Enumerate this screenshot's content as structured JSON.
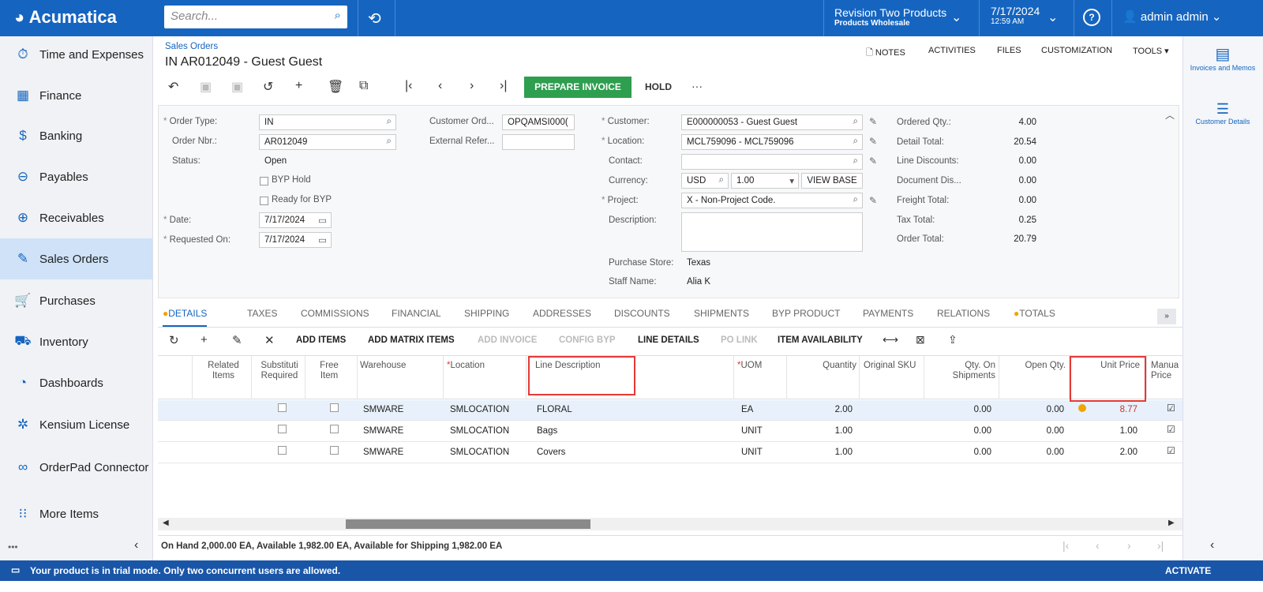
{
  "topbar": {
    "logo": "Acumatica",
    "search_placeholder": "Search...",
    "company": "Revision Two Products",
    "branch": "Products Wholesale",
    "date": "7/17/2024",
    "time": "12:59 AM",
    "user": "admin admin"
  },
  "sidebar": {
    "items": [
      {
        "label": "Time and Expenses",
        "icon": "stopwatch-icon"
      },
      {
        "label": "Finance",
        "icon": "calculator-icon"
      },
      {
        "label": "Banking",
        "icon": "dollar-icon"
      },
      {
        "label": "Payables",
        "icon": "minus-circle-icon"
      },
      {
        "label": "Receivables",
        "icon": "plus-circle-icon"
      },
      {
        "label": "Sales Orders",
        "icon": "edit-icon",
        "active": true
      },
      {
        "label": "Purchases",
        "icon": "cart-icon"
      },
      {
        "label": "Inventory",
        "icon": "truck-icon"
      },
      {
        "label": "Dashboards",
        "icon": "gauge-icon"
      },
      {
        "label": "Kensium License",
        "icon": "kensium-icon"
      },
      {
        "label": "OrderPad Connector",
        "icon": "orderpad-icon"
      },
      {
        "label": "More Items",
        "icon": "grid-icon"
      }
    ]
  },
  "header": {
    "breadcrumb": "Sales Orders",
    "title": "IN AR012049 - Guest Guest",
    "links": [
      "NOTES",
      "ACTIVITIES",
      "FILES",
      "CUSTOMIZATION",
      "TOOLS"
    ],
    "prepare_invoice": "PREPARE INVOICE",
    "hold": "HOLD",
    "more": "···"
  },
  "form": {
    "order_type_label": "Order Type:",
    "order_type": "IN",
    "order_nbr_label": "Order Nbr.:",
    "order_nbr": "AR012049",
    "status_label": "Status:",
    "status": "Open",
    "byp_hold": "BYP Hold",
    "ready_byp": "Ready for BYP",
    "date_label": "Date:",
    "date": "7/17/2024",
    "requested_label": "Requested On:",
    "requested": "7/17/2024",
    "cust_ord_label": "Customer Ord...",
    "cust_ord": "OPQAMSI000(",
    "ext_ref_label": "External Refer...",
    "ext_ref": "",
    "customer_label": "Customer:",
    "customer": "E000000053 - Guest Guest",
    "location_label": "Location:",
    "location": "MCL759096 - MCL759096",
    "contact_label": "Contact:",
    "contact": "",
    "currency_label": "Currency:",
    "currency": "USD",
    "rate": "1.00",
    "view_base": "VIEW BASE",
    "project_label": "Project:",
    "project": "X - Non-Project Code.",
    "description_label": "Description:",
    "description": "",
    "store_label": "Purchase Store:",
    "store": "Texas",
    "staff_label": "Staff Name:",
    "staff": "Alia K"
  },
  "totals": [
    {
      "label": "Ordered Qty.:",
      "value": "4.00"
    },
    {
      "label": "Detail Total:",
      "value": "20.54"
    },
    {
      "label": "Line Discounts:",
      "value": "0.00"
    },
    {
      "label": "Document Dis...",
      "value": "0.00"
    },
    {
      "label": "Freight Total:",
      "value": "0.00"
    },
    {
      "label": "Tax Total:",
      "value": "0.25"
    },
    {
      "label": "Order Total:",
      "value": "20.79"
    }
  ],
  "tabs": [
    "DETAILS",
    "TAXES",
    "COMMISSIONS",
    "FINANCIAL",
    "SHIPPING",
    "ADDRESSES",
    "DISCOUNTS",
    "SHIPMENTS",
    "BYP PRODUCT",
    "PAYMENTS",
    "RELATIONS",
    "TOTALS"
  ],
  "grid_toolbar": [
    {
      "label": "ADD ITEMS"
    },
    {
      "label": "ADD MATRIX ITEMS"
    },
    {
      "label": "ADD INVOICE",
      "disabled": true
    },
    {
      "label": "CONFIG BYP",
      "disabled": true
    },
    {
      "label": "LINE DETAILS"
    },
    {
      "label": "PO LINK",
      "disabled": true
    },
    {
      "label": "ITEM AVAILABILITY"
    }
  ],
  "columns": [
    "Related Items",
    "Substituti Required",
    "Free Item",
    "Warehouse",
    "Location",
    "Line Description",
    "UOM",
    "Quantity",
    "Original SKU",
    "Qty. On Shipments",
    "Open Qty.",
    "Unit Price",
    "Manua Price"
  ],
  "rows": [
    {
      "warehouse": "SMWARE",
      "location": "SMLOCATION",
      "desc": "FLORAL",
      "uom": "EA",
      "qty": "2.00",
      "qty_ship": "0.00",
      "open_qty": "0.00",
      "unit_price": "8.77",
      "warning": true
    },
    {
      "warehouse": "SMWARE",
      "location": "SMLOCATION",
      "desc": "Bags",
      "uom": "UNIT",
      "qty": "1.00",
      "qty_ship": "0.00",
      "open_qty": "0.00",
      "unit_price": "1.00"
    },
    {
      "warehouse": "SMWARE",
      "location": "SMLOCATION",
      "desc": "Covers",
      "uom": "UNIT",
      "qty": "1.00",
      "qty_ship": "0.00",
      "open_qty": "0.00",
      "unit_price": "2.00"
    }
  ],
  "footer_status": "On Hand 2,000.00 EA, Available 1,982.00 EA, Available for Shipping 1,982.00 EA",
  "right_panel": [
    {
      "label": "Invoices and Memos"
    },
    {
      "label": "Customer Details"
    }
  ],
  "bottom": {
    "message": "Your product is in trial mode. Only two concurrent users are allowed.",
    "activate": "ACTIVATE"
  },
  "colors": {
    "brand": "#1565c0",
    "primary_button": "#2e9e4f",
    "highlight": "#e53935"
  }
}
